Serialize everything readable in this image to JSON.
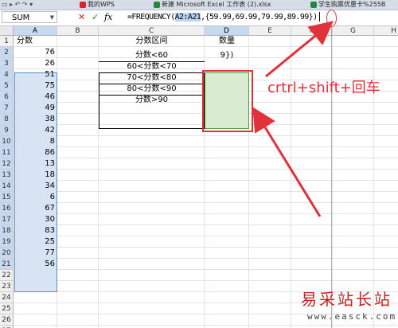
{
  "tabs": [
    {
      "label": "我的WPS",
      "color": "#d9232b"
    },
    {
      "label": "新建 Microsoft Excel 工作表 (2).xlsx",
      "color": "#1f8a3a"
    },
    {
      "label": "学生购票优惠卡%255B",
      "color": "#1f8a3a"
    }
  ],
  "formula_bar": {
    "name_box": "SUM",
    "cancel_glyph": "✕",
    "confirm_glyph": "✓",
    "fx_label": "fx",
    "prefix": "=FREQUENCY(",
    "range_ref": "A2:A21",
    "suffix": ",{59.99,69.99,79.99,89.99})"
  },
  "columns": [
    "A",
    "B",
    "C",
    "D",
    "E",
    "F",
    "G",
    "H"
  ],
  "selected_columns": [
    "A",
    "D"
  ],
  "row_numbers": [
    "1",
    "2",
    "3",
    "4",
    "5",
    "6",
    "7",
    "8",
    "9",
    "10",
    "11",
    "12",
    "13",
    "14",
    "15",
    "16",
    "17",
    "18",
    "19",
    "20",
    "21",
    "22",
    "23",
    "24",
    "25",
    "26",
    "27"
  ],
  "column_a": {
    "header": "分数",
    "values": [
      "76",
      "26",
      "51",
      "75",
      "46",
      "49",
      "38",
      "42",
      "8",
      "86",
      "13",
      "18",
      "34",
      "6",
      "67",
      "30",
      "83",
      "25",
      "77",
      "56"
    ]
  },
  "column_c": {
    "header": "分数区间",
    "values": [
      "分数<60",
      "60<分数<70",
      "70<分数<80",
      "80<分数<90",
      "分数>90"
    ]
  },
  "column_d": {
    "header": "数量",
    "editing_value": "9})"
  },
  "annotation": {
    "callout": "crtrl+shift+回车",
    "color": "#e0323a"
  },
  "watermark": {
    "title": "易采站长站",
    "url": "www.easck.com"
  }
}
